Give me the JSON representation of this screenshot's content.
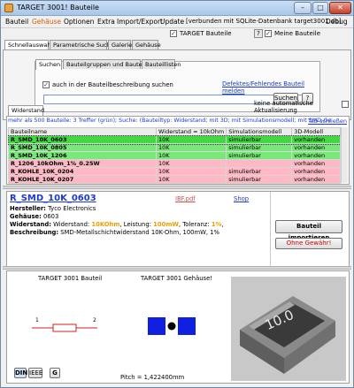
{
  "window": {
    "title": "TARGET 3001! Bauteile",
    "min_glyph": "–",
    "max_glyph": "□",
    "close_glyph": "✕"
  },
  "menu": [
    "Bauteil",
    "Gehäuse",
    "Optionen",
    "Extra",
    "Import/Export",
    "Update",
    "[verbunden mit SQLite-Datenbank target3001.db]",
    "Debug"
  ],
  "options": {
    "target_bauteile_label": "TARGET Bauteile",
    "meine_bauteile_label": "Meine Bauteile",
    "help_label": "?",
    "check_glyph": "✓"
  },
  "main_tabs": [
    "Schnellauswahl",
    "Parametrische Suche",
    "Galerie",
    "Gehäuse"
  ],
  "search": {
    "tabs": [
      "Suchen",
      "Bauteilgruppen und Bauteiltypen",
      "Bauteillisten"
    ],
    "also_desc_label": "auch in der Bauteilbeschreibung suchen",
    "report_link": "Defektes/Fehlendes Bauteil melden",
    "input_value": "",
    "search_button": "Suchen",
    "help_button": "?",
    "auto_update_label": "keine automatische Aktualisierung"
  },
  "results": {
    "tab_label": "Widerstand",
    "info_text": "mehr als 500 Bauteile: 3 Treffer (grün); Suche: (Bauteiltyp: Widerstand; mit 3D; mit Simulationsmodell; mit SMD-Ge",
    "close_tab_link": "Tab schließen",
    "columns": [
      "Bauteilname",
      "Widerstand = 10kOhm",
      "Simulationsmodell",
      "3D-Modell"
    ],
    "rows": [
      {
        "name": "R_SMD_10K_0603",
        "value": "10K",
        "sim": "simulierbar",
        "model3d": "vorhanden",
        "style": "green sel"
      },
      {
        "name": "R_SMD_10K_0805",
        "value": "10K",
        "sim": "simulierbar",
        "model3d": "vorhanden",
        "style": "green"
      },
      {
        "name": "R_SMD_10K_1206",
        "value": "10K",
        "sim": "simulierbar",
        "model3d": "vorhanden",
        "style": "green"
      },
      {
        "name": "R_1206_10kOhm_1%_0.25W",
        "value": "10K",
        "sim": "",
        "model3d": "vorhanden",
        "style": "pink"
      },
      {
        "name": "R_KOHLE_10K_0204",
        "value": "10K",
        "sim": "simulierbar",
        "model3d": "vorhanden",
        "style": "pink"
      },
      {
        "name": "R_KOHLE_10K_0207",
        "value": "10K",
        "sim": "simulierbar",
        "model3d": "vorhanden",
        "style": "pink"
      }
    ]
  },
  "detail": {
    "name": "R_SMD_10K_0603",
    "ibf_link": "IBF.pdf",
    "shop_link": "Shop",
    "hersteller_label": "Hersteller:",
    "hersteller_value": "Tyco Electronics",
    "gehaeuse_label": "Gehäuse:",
    "gehaeuse_value": "0603",
    "widerstand_label": "Widerstand:",
    "widerstand_text_1": "Widerstand:",
    "widerstand_hl_1": "10KOhm",
    "widerstand_text_2": ", Leistung:",
    "widerstand_hl_2": "100mW",
    "widerstand_text_3": ", Toleranz:",
    "widerstand_hl_3": "1%",
    "widerstand_text_4": ",",
    "beschreibung_label": "Beschreibung:",
    "beschreibung_value": "SMD-Metallschichtwiderstand 10K-Ohm, 100mW, 1%",
    "import_button": "Bauteil importieren",
    "warranty_button": "Ohne Gewähr!"
  },
  "preview": {
    "schematic_title": "TARGET 3001 Bauteil",
    "package_title": "TARGET 3001 Gehäuse!",
    "pin1": "1",
    "pin2": "2",
    "pitch_text": "Pitch = 1,422400mm",
    "view_buttons": [
      "DIN",
      "IEEE",
      "G"
    ],
    "model_label": "10.0"
  },
  "colors": {
    "accent_orange": "#d85c00",
    "link_blue": "#1a3ad0",
    "row_green": "#78e878",
    "row_pink": "#ffb8c4",
    "pad_blue": "#1020e0"
  }
}
